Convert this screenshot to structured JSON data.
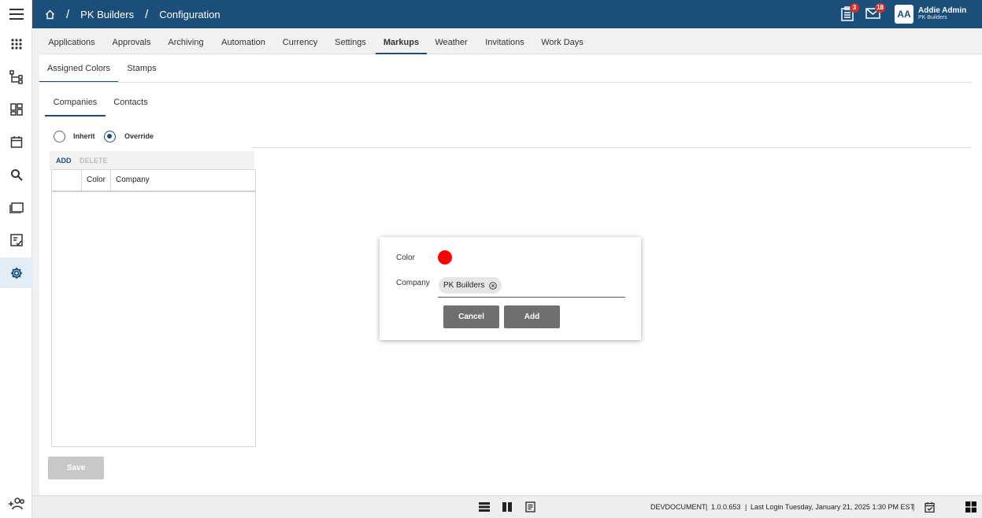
{
  "header": {
    "breadcrumb": [
      "PK Builders",
      "Configuration"
    ],
    "separator": "/",
    "tasks_badge": "3",
    "mail_badge": "18",
    "user_initials": "AA",
    "user_name": "Addie Admin",
    "user_company": "PK Builders"
  },
  "tabs": [
    "Applications",
    "Approvals",
    "Archiving",
    "Automation",
    "Currency",
    "Settings",
    "Markups",
    "Weather",
    "Invitations",
    "Work Days"
  ],
  "subtabs": [
    "Assigned Colors",
    "Stamps"
  ],
  "entity_tabs": [
    "Companies",
    "Contacts"
  ],
  "radios": {
    "inherit": "Inherit",
    "override": "Override",
    "selected": "Override"
  },
  "grid": {
    "add_label": "ADD",
    "delete_label": "DELETE",
    "columns": [
      "Color",
      "Company"
    ]
  },
  "save_label": "Save",
  "dialog": {
    "color_label": "Color",
    "color_value": "#ff0000",
    "company_label": "Company",
    "company_chip": "PK Builders",
    "cancel_label": "Cancel",
    "add_label": "Add"
  },
  "footer": {
    "env": "DEVDOCUMENT",
    "sep": "|",
    "version": "1.0.0.653",
    "last_login": "Last Login Tuesday, January 21, 2025 1:30 PM EST"
  },
  "colors": {
    "brand": "#1b4f7a",
    "badge": "#d32f2f"
  }
}
